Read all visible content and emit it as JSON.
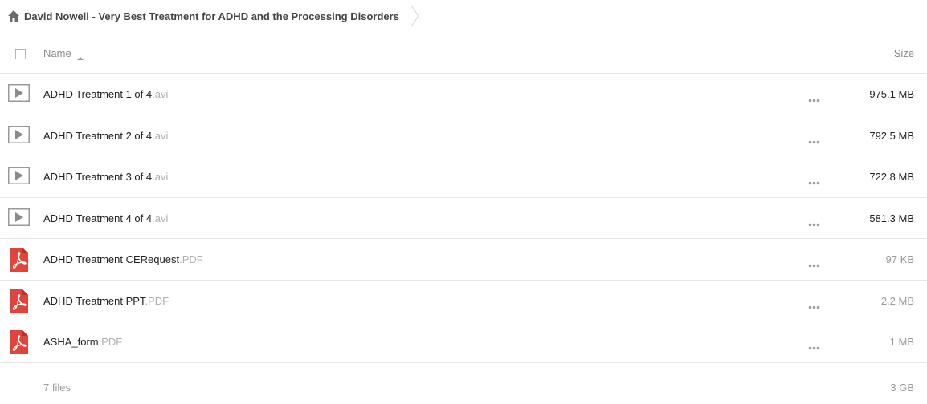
{
  "breadcrumb": {
    "home_icon": "home-icon",
    "title": "David Nowell - Very Best Treatment for ADHD and the Processing Disorders"
  },
  "header": {
    "name_label": "Name",
    "size_label": "Size",
    "sort_icon": "sort-ascending-icon"
  },
  "files": [
    {
      "name": "ADHD Treatment 1 of 4",
      "ext": ".avi",
      "type": "video",
      "icon": "video-play-icon",
      "size": "975.1 MB"
    },
    {
      "name": "ADHD Treatment 2 of 4",
      "ext": ".avi",
      "type": "video",
      "icon": "video-play-icon",
      "size": "792.5 MB"
    },
    {
      "name": "ADHD Treatment 3 of 4",
      "ext": ".avi",
      "type": "video",
      "icon": "video-play-icon",
      "size": "722.8 MB"
    },
    {
      "name": "ADHD Treatment 4 of 4",
      "ext": ".avi",
      "type": "video",
      "icon": "video-play-icon",
      "size": "581.3 MB"
    },
    {
      "name": "ADHD Treatment CERequest",
      "ext": ".PDF",
      "type": "pdf",
      "icon": "pdf-icon",
      "size": "97 KB"
    },
    {
      "name": "ADHD Treatment PPT",
      "ext": ".PDF",
      "type": "pdf",
      "icon": "pdf-icon",
      "size": "2.2 MB"
    },
    {
      "name": "ASHA_form",
      "ext": ".PDF",
      "type": "pdf",
      "icon": "pdf-icon",
      "size": "1 MB"
    }
  ],
  "footer": {
    "count": "7 files",
    "total": "3 GB"
  },
  "colors": {
    "pdf_red": "#e0443a",
    "video_gray": "#9a9a9a",
    "divider": "#e6e6e6"
  }
}
